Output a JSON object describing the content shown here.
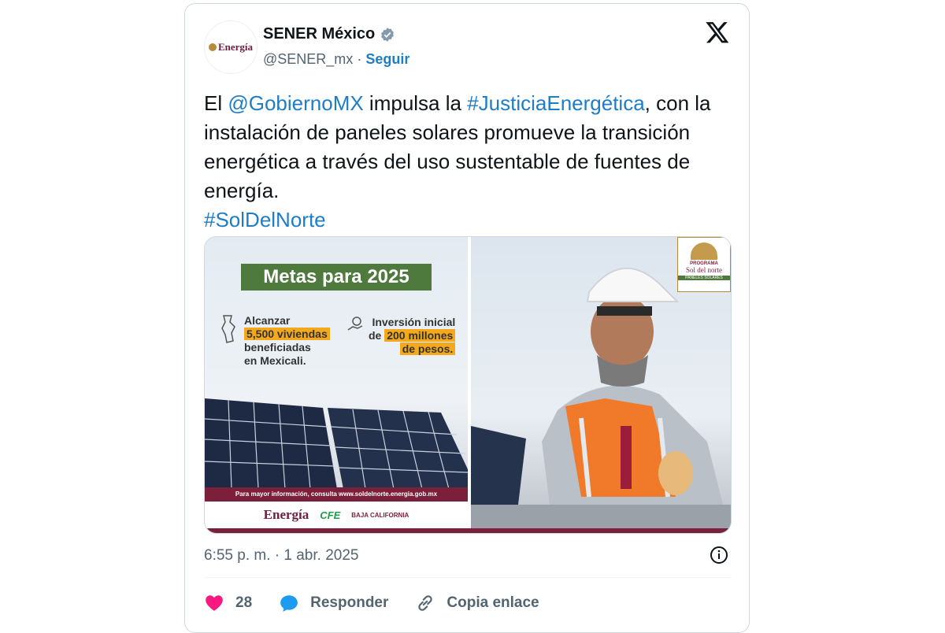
{
  "author": {
    "name": "SENER México",
    "handle": "@SENER_mx",
    "separator": "·",
    "follow_label": "Seguir",
    "avatar_text": "Energía"
  },
  "tweet": {
    "t1": "El ",
    "mention": "@GobiernoMX",
    "t2": " impulsa la ",
    "hashtag1": "#JusticiaEnergética",
    "t3": ", con la instalación de paneles solares promueve la transición energética a través del uso sustentable de fuentes de energía.",
    "hashtag2": "#SolDelNorte"
  },
  "media": {
    "headline": "Metas para 2025",
    "stat1_line1": "Alcanzar",
    "stat1_highlight": "5,500 viviendas",
    "stat1_line3": "beneficiadas",
    "stat1_line4": "en Mexicali.",
    "stat2_line1": "Inversión inicial",
    "stat2_prefix": "de ",
    "stat2_highlight": "200 millones",
    "stat2_line3": "de pesos.",
    "info_bar": "Para mayor información, consulta www.soldelnorte.energia.gob.mx",
    "logo_energia": "Energía",
    "logo_cfe": "CFE",
    "logo_baja": "BAJA CALIFORNIA",
    "badge_programa": "PROGRAMA",
    "badge_name": "Sol del norte",
    "badge_sub": "PANELES SOLARES"
  },
  "meta": {
    "timestamp": "6:55 p. m. · 1 abr. 2025"
  },
  "actions": {
    "likes": "28",
    "reply_label": "Responder",
    "copy_label": "Copia enlace"
  },
  "colors": {
    "link": "#1d7dc7",
    "like": "#f91880",
    "reply": "#1d9bf0",
    "brand": "#7b1f3b"
  }
}
